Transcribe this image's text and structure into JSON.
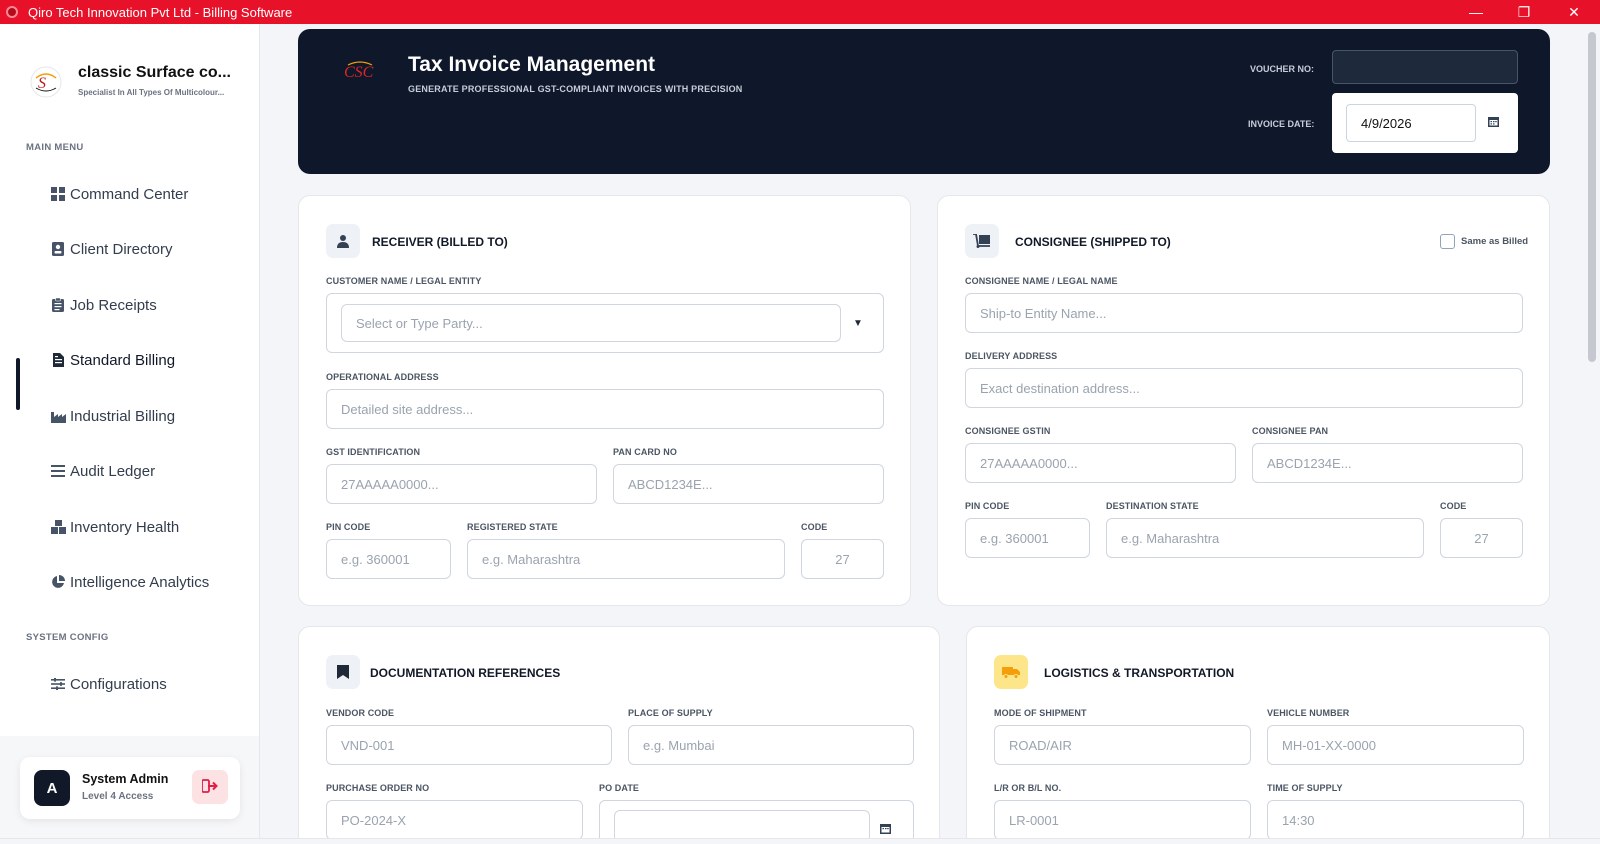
{
  "window": {
    "title": "Qiro Tech Innovation Pvt Ltd - Billing Software",
    "minimize": "—",
    "restore": "❐",
    "close": "✕"
  },
  "brand": {
    "name": "classic Surface co...",
    "tagline": "Specialist In All Types Of Multicolour..."
  },
  "sidebar": {
    "main_menu_label": "MAIN MENU",
    "items": [
      {
        "label": "Command Center",
        "icon": "grid-icon"
      },
      {
        "label": "Client Directory",
        "icon": "contact-card-icon"
      },
      {
        "label": "Job Receipts",
        "icon": "clipboard-icon"
      },
      {
        "label": "Standard Billing",
        "icon": "invoice-icon",
        "active": true
      },
      {
        "label": "Industrial Billing",
        "icon": "factory-icon"
      },
      {
        "label": "Audit Ledger",
        "icon": "list-icon"
      },
      {
        "label": "Inventory Health",
        "icon": "boxes-icon"
      },
      {
        "label": "Intelligence Analytics",
        "icon": "pie-chart-icon"
      }
    ],
    "system_config_label": "SYSTEM CONFIG",
    "config_item": {
      "label": "Configurations",
      "icon": "sliders-icon"
    }
  },
  "user": {
    "avatar_initial": "A",
    "name": "System Admin",
    "role": "Level 4 Access"
  },
  "header": {
    "title": "Tax Invoice Management",
    "subtitle": "GENERATE PROFESSIONAL GST-COMPLIANT INVOICES WITH PRECISION",
    "voucher_label": "VOUCHER NO:",
    "voucher_value": "",
    "date_label": "INVOICE DATE:",
    "date_value": "4/9/2026"
  },
  "receiver": {
    "title": "RECEIVER (BILLED TO)",
    "customer_label": "CUSTOMER NAME / LEGAL ENTITY",
    "customer_placeholder": "Select or Type Party...",
    "address_label": "OPERATIONAL ADDRESS",
    "address_placeholder": "Detailed site address...",
    "gst_label": "GST IDENTIFICATION",
    "gst_placeholder": "27AAAAA0000...",
    "pan_label": "PAN CARD NO",
    "pan_placeholder": "ABCD1234E...",
    "pin_label": "PIN CODE",
    "pin_placeholder": "e.g. 360001",
    "state_label": "REGISTERED STATE",
    "state_placeholder": "e.g. Maharashtra",
    "code_label": "CODE",
    "code_value": "27"
  },
  "consignee": {
    "title": "CONSIGNEE (SHIPPED TO)",
    "same_as_label": "Same as Billed",
    "name_label": "CONSIGNEE NAME / LEGAL NAME",
    "name_placeholder": "Ship-to Entity Name...",
    "address_label": "DELIVERY ADDRESS",
    "address_placeholder": "Exact destination address...",
    "gstin_label": "CONSIGNEE GSTIN",
    "gstin_placeholder": "27AAAAA0000...",
    "pan_label": "CONSIGNEE PAN",
    "pan_placeholder": "ABCD1234E...",
    "pin_label": "PIN CODE",
    "pin_placeholder": "e.g. 360001",
    "state_label": "DESTINATION STATE",
    "state_placeholder": "e.g. Maharashtra",
    "code_label": "CODE",
    "code_value": "27"
  },
  "documentation": {
    "title": "DOCUMENTATION REFERENCES",
    "vendor_label": "VENDOR CODE",
    "vendor_placeholder": "VND-001",
    "place_label": "PLACE OF SUPPLY",
    "place_placeholder": "e.g. Mumbai",
    "po_label": "PURCHASE ORDER NO",
    "po_placeholder": "PO-2024-X",
    "po_date_label": "PO DATE",
    "po_date_value": ""
  },
  "logistics": {
    "title": "LOGISTICS & TRANSPORTATION",
    "mode_label": "MODE OF SHIPMENT",
    "mode_placeholder": "ROAD/AIR",
    "vehicle_label": "VEHICLE NUMBER",
    "vehicle_placeholder": "MH-01-XX-0000",
    "lr_label": "L/R OR B/L NO.",
    "lr_placeholder": "LR-0001",
    "time_label": "TIME OF SUPPLY",
    "time_placeholder": "14:30"
  },
  "colors": {
    "titlebar": "#e8112a",
    "header_bg": "#0f172a",
    "accent_red": "#e11d48",
    "logistics_icon_bg": "#fde68a",
    "logistics_icon": "#f59e0b"
  }
}
